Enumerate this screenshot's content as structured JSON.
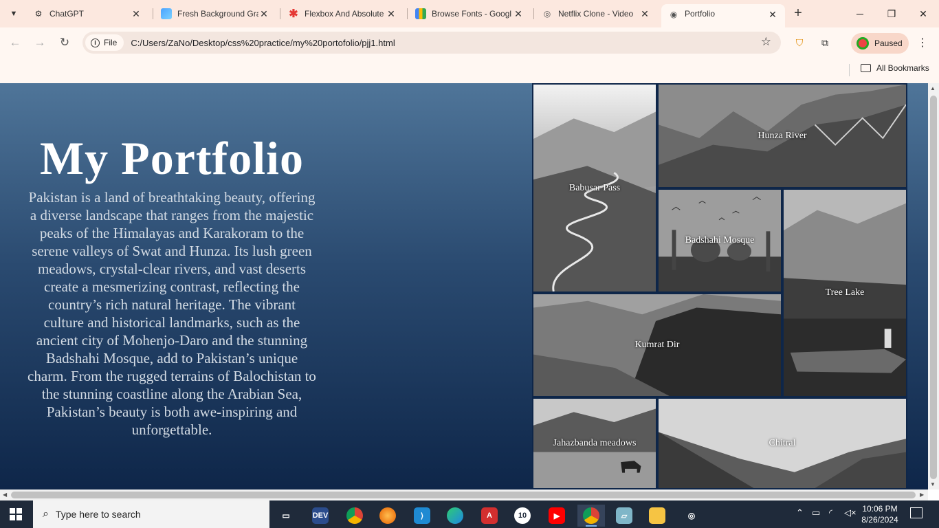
{
  "browser": {
    "tabs": [
      {
        "title": "ChatGPT",
        "favicon": "chatgpt-icon"
      },
      {
        "title": "Fresh Background Gra",
        "favicon": "gradient-icon"
      },
      {
        "title": "Flexbox And Absolute",
        "favicon": "asterisk-icon"
      },
      {
        "title": "Browse Fonts - Googl",
        "favicon": "google-fonts-icon"
      },
      {
        "title": "Netflix Clone - Video",
        "favicon": "video-icon"
      },
      {
        "title": "Portfolio",
        "favicon": "globe-icon",
        "active": true
      }
    ],
    "address": {
      "chip_label": "File",
      "url": "C:/Users/ZaNo/Desktop/css%20practice/my%20portofolio/pjj1.html"
    },
    "profile_label": "Paused",
    "bookmarks_label": "All Bookmarks"
  },
  "page": {
    "title": "My Portfolio",
    "description": "Pakistan is a land of breathtaking beauty, offering a diverse landscape that ranges from the majestic peaks of the Himalayas and Karakoram to the serene valleys of Swat and Hunza. Its lush green meadows, crystal-clear rivers, and vast deserts create a mesmerizing contrast, reflecting the country’s rich natural heritage. The vibrant culture and historical landmarks, such as the ancient city of Mohenjo-Daro and the stunning Badshahi Mosque, add to Pakistan’s unique charm. From the rugged terrains of Balochistan to the stunning coastline along the Arabian Sea, Pakistan’s beauty is both awe-inspiring and unforgettable.",
    "gallery": [
      {
        "caption": "Babusar Pass"
      },
      {
        "caption": "Hunza River"
      },
      {
        "caption": "Badshahi Mosque"
      },
      {
        "caption": "Tree Lake"
      },
      {
        "caption": "Kumrat Dir"
      },
      {
        "caption": "Jahazbanda meadows"
      },
      {
        "caption": "Chitral"
      }
    ]
  },
  "taskbar": {
    "search_placeholder": "Type here to search",
    "time": "10:06 PM",
    "date": "8/26/2024",
    "badge_count": "10"
  },
  "colors": {
    "page_gradient_top": "#4f7599",
    "page_gradient_bottom": "#0e2649",
    "tabstrip_bg": "#fce8df",
    "taskbar_bg": "#1f2a3a"
  }
}
